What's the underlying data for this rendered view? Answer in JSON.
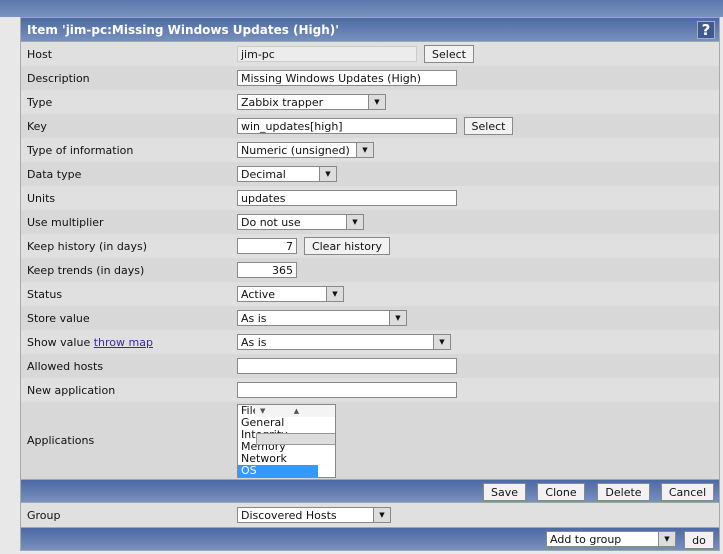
{
  "title": "Item 'jim-pc:Missing Windows Updates (High)'",
  "help": "?",
  "fields": {
    "host": {
      "label": "Host",
      "value": "jim-pc",
      "button": "Select"
    },
    "description": {
      "label": "Description",
      "value": "Missing Windows Updates (High)"
    },
    "type": {
      "label": "Type",
      "value": "Zabbix trapper"
    },
    "key": {
      "label": "Key",
      "value": "win_updates[high]",
      "button": "Select"
    },
    "type_info": {
      "label": "Type of information",
      "value": "Numeric (unsigned)"
    },
    "data_type": {
      "label": "Data type",
      "value": "Decimal"
    },
    "units": {
      "label": "Units",
      "value": "updates"
    },
    "multiplier": {
      "label": "Use multiplier",
      "value": "Do not use"
    },
    "history": {
      "label": "Keep history (in days)",
      "value": "7",
      "button": "Clear history"
    },
    "trends": {
      "label": "Keep trends (in days)",
      "value": "365"
    },
    "status": {
      "label": "Status",
      "value": "Active"
    },
    "store": {
      "label": "Store value",
      "value": "As is"
    },
    "show": {
      "label": "Show value",
      "link": "throw map",
      "value": "As is"
    },
    "allowed": {
      "label": "Allowed hosts",
      "value": ""
    },
    "new_app": {
      "label": "New application",
      "value": ""
    },
    "apps": {
      "label": "Applications",
      "options": [
        "Filesystem",
        "General",
        "Integrity",
        "Memory",
        "Network",
        "OS"
      ],
      "selected": "OS"
    }
  },
  "actions": {
    "save": "Save",
    "clone": "Clone",
    "delete": "Delete",
    "cancel": "Cancel"
  },
  "group": {
    "label": "Group",
    "value": "Discovered Hosts"
  },
  "footer": {
    "action": "Add to group",
    "do": "do"
  }
}
